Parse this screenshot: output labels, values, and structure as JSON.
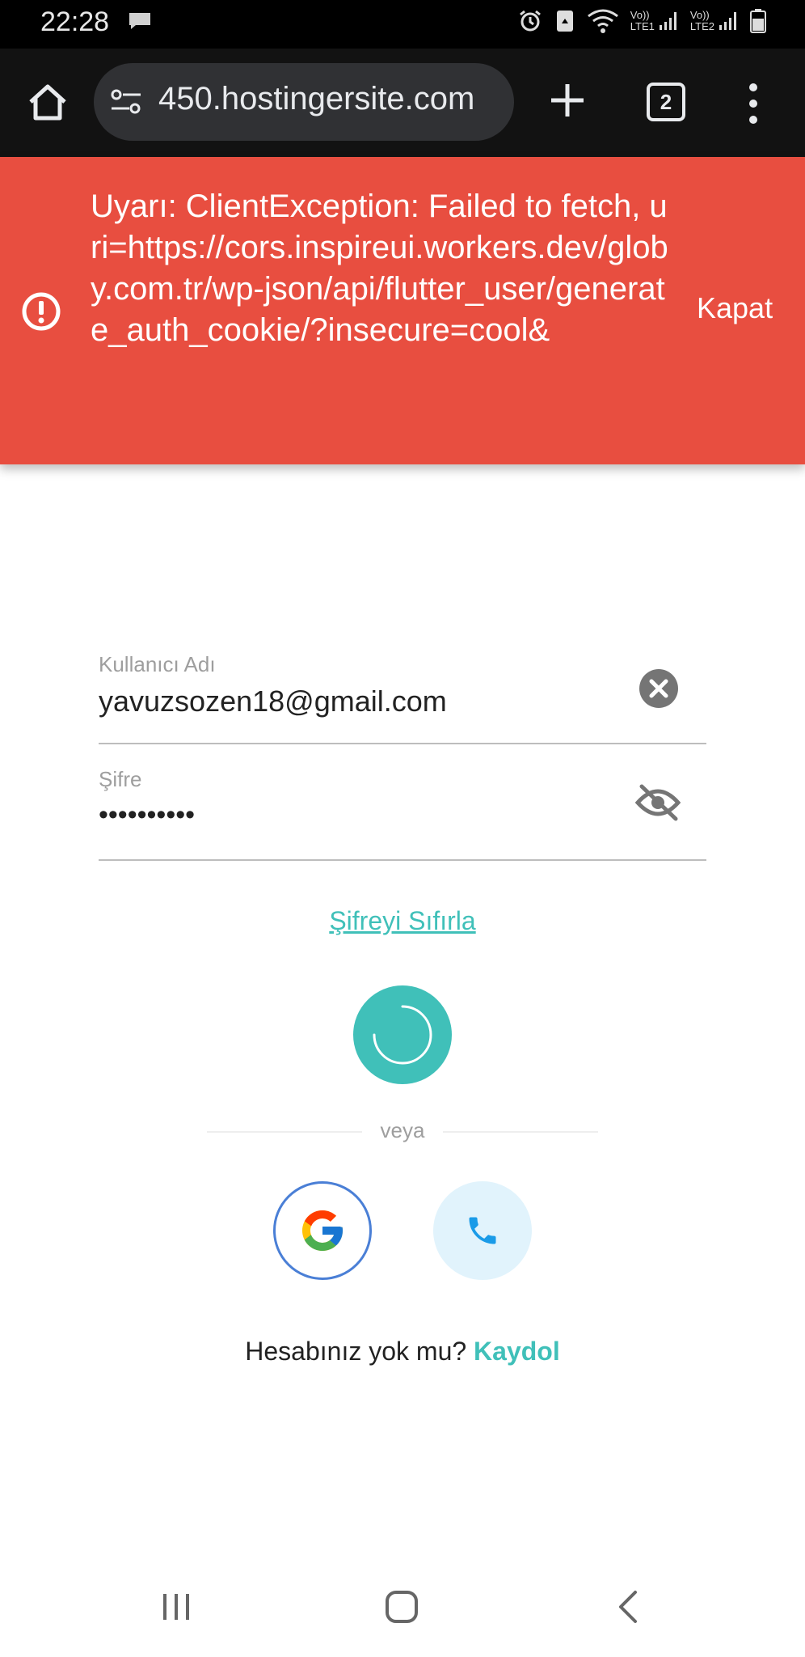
{
  "status_bar": {
    "time": "22:28",
    "icons": [
      "message-icon",
      "alarm-icon",
      "recycle-icon",
      "wifi-icon",
      "lte1-signal-icon",
      "lte2-signal-icon",
      "battery-icon"
    ],
    "lte1_label_top": "Vo))",
    "lte1_label_bottom": "LTE1",
    "lte2_label_top": "Vo))",
    "lte2_label_bottom": "LTE2"
  },
  "browser": {
    "url": "450.hostingersite.com",
    "tab_count": "2"
  },
  "alert": {
    "message": "Uyarı: ClientException: Failed to fetch, uri=https://cors.inspireui.workers.dev/globy.com.tr/wp-json/api/flutter_user/generate_auth_cookie/?insecure=cool&",
    "close_label": "Kapat",
    "color": "#e84e40"
  },
  "form": {
    "username_label": "Kullanıcı Adı",
    "username_value": "yavuzsozen18@gmail.com",
    "password_label": "Şifre",
    "password_value": "••••••••••",
    "reset_link": "Şifreyi Sıfırla",
    "or_text": "veya",
    "no_account_text": "Hesabınız yok mu?",
    "signup_link": "Kaydol",
    "accent_color": "#40c0b9"
  },
  "nav": {
    "icons": [
      "recent-apps-icon",
      "home-icon",
      "back-icon"
    ]
  }
}
